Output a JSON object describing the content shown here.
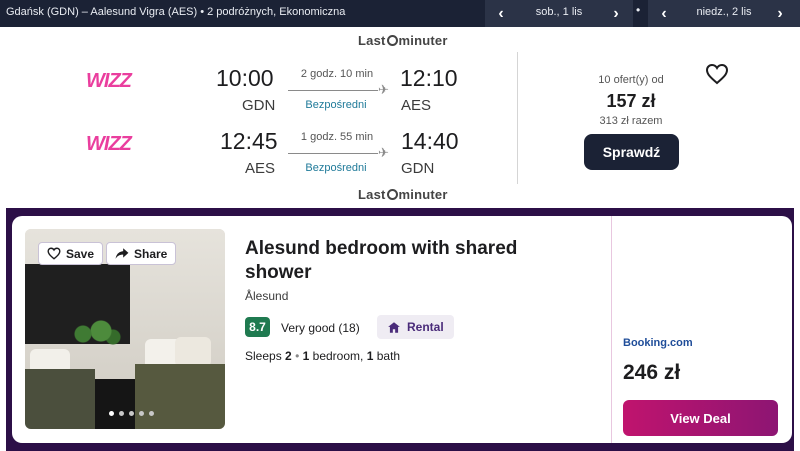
{
  "topbar": {
    "route": "Gdańsk (GDN) – Aalesund Vigra (AES)  •  2 podróżnych, Ekonomiczna",
    "depart_date": "sob., 1 lis",
    "return_date": "niedz., 2 lis",
    "separator": "•"
  },
  "flight": {
    "brand": [
      "Last",
      "minuter"
    ],
    "airline": [
      "WI",
      "ZZ"
    ],
    "outbound": {
      "dep_time": "10:00",
      "dep_code": "GDN",
      "duration": "2 godz. 10 min",
      "stops": "Bezpośredni",
      "arr_time": "12:10",
      "arr_code": "AES"
    },
    "inbound": {
      "dep_time": "12:45",
      "dep_code": "AES",
      "duration": "1 godz. 55 min",
      "stops": "Bezpośredni",
      "arr_time": "14:40",
      "arr_code": "GDN"
    },
    "offers": "10 ofert(y) od",
    "price": "157 zł",
    "total": "313 zł razem",
    "check_label": "Sprawdź"
  },
  "hotel": {
    "save_label": "Save",
    "share_label": "Share",
    "title": "Alesund bedroom with shared shower",
    "city": "Ålesund",
    "score": "8.7",
    "score_text": "Very good (18)",
    "type_label": "Rental",
    "sleeps_prefix": "Sleeps",
    "sleeps_count": "2",
    "bedrooms_count": "1",
    "bedrooms_label": "bedroom,",
    "bath_count": "1",
    "bath_label": "bath",
    "bullet": "•",
    "provider": "Booking.com",
    "price": "246 zł",
    "deal_label": "View Deal"
  },
  "icons": {
    "chevron_left": "‹",
    "chevron_right": "›",
    "plane": "✈",
    "heart": "heart-icon",
    "share": "share-icon",
    "house": "house-icon"
  },
  "colors": {
    "topbar": "#1b2235",
    "wizz": "#c2007a",
    "direct": "#1f7a99",
    "score": "#1f7a50",
    "deal": "#c0146e",
    "frame": "#2c0f47"
  }
}
